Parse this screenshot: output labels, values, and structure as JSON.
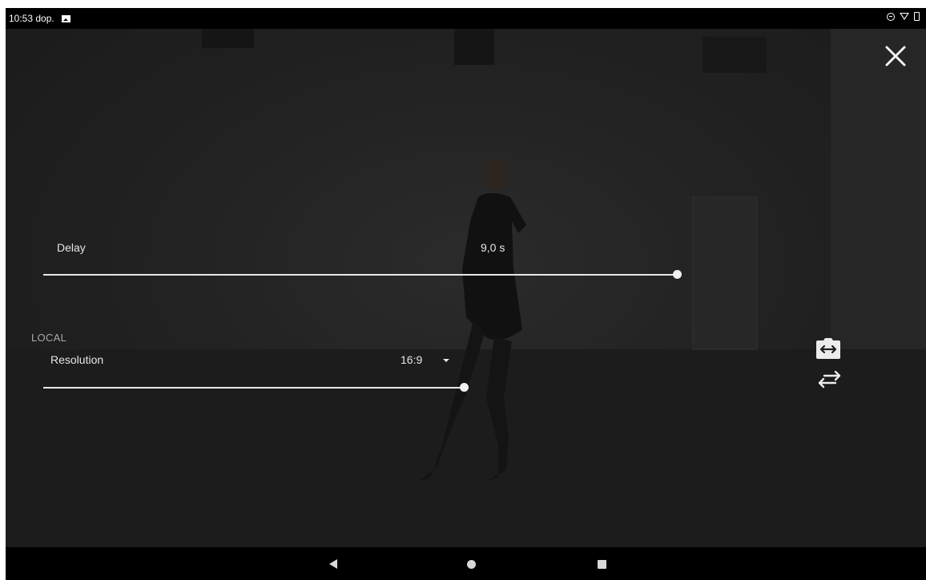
{
  "status_bar": {
    "time": "10:53 dop.",
    "icons": [
      "image-notification-icon",
      "do-not-disturb-icon",
      "wifi-icon",
      "battery-icon"
    ]
  },
  "controls": {
    "delay": {
      "label": "Delay",
      "value": "9,0 s",
      "slider_fraction": 1.0
    },
    "section_local": "LOCAL",
    "resolution": {
      "label": "Resolution",
      "value": "16:9",
      "slider_fraction": 1.0
    }
  },
  "actions": {
    "close_icon": "close-icon",
    "flip_camera_icon": "camera-flip-icon",
    "swap_icon": "swap-horizontal-icon"
  },
  "nav_bar": {
    "icons": [
      "back-icon",
      "home-icon",
      "recents-icon"
    ]
  },
  "colors": {
    "overlay": "#222222",
    "text": "#e6e6e6",
    "bars": "#000000"
  }
}
